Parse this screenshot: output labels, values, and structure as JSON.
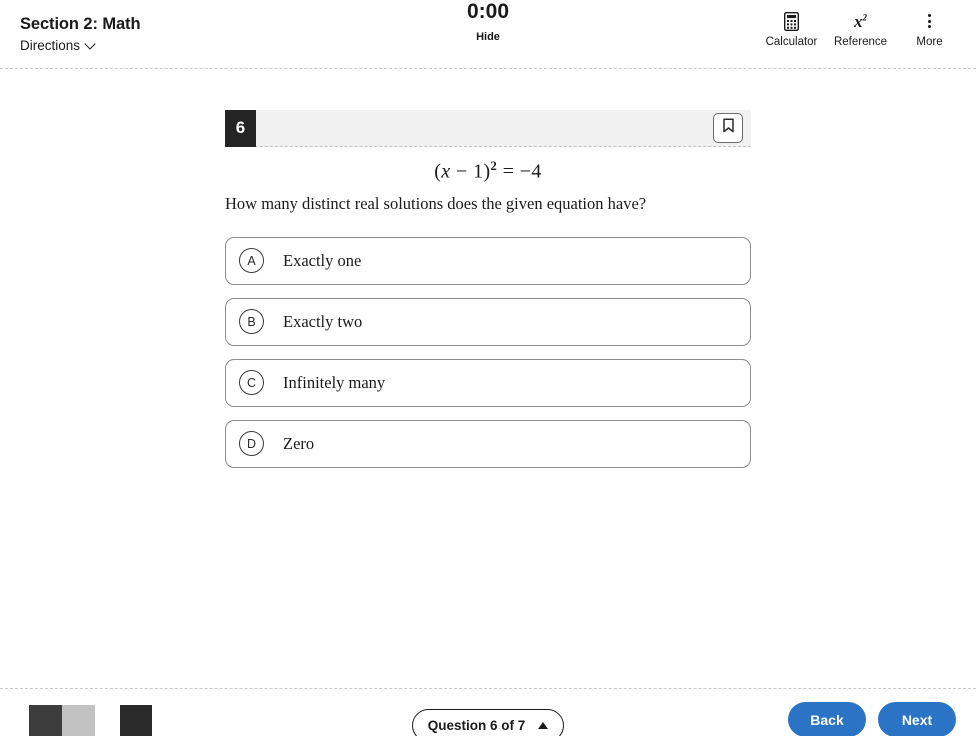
{
  "header": {
    "section_title": "Section 2: Math",
    "directions_label": "Directions",
    "directions_icon": "chevron-down-icon",
    "timer_value": "0:00",
    "timer_toggle_label": "Hide",
    "tools": [
      {
        "label": "Calculator",
        "icon": "calculator-icon"
      },
      {
        "label": "Reference",
        "icon": "x-squared-icon",
        "glyph_base": "x",
        "glyph_sup": "2"
      },
      {
        "label": "More",
        "icon": "kebab-menu-icon"
      }
    ]
  },
  "question": {
    "number": "6",
    "bookmark_icon": "bookmark-icon",
    "equation": {
      "lparen": "(",
      "variable": "x",
      "minus": " − ",
      "one": "1",
      "rparen": ")",
      "exponent": "2",
      "equals": " = ",
      "rhs": "−4"
    },
    "prompt": "How many distinct real solutions does the given equation have?",
    "choices": [
      {
        "letter": "A",
        "text": "Exactly one"
      },
      {
        "letter": "B",
        "text": "Exactly two"
      },
      {
        "letter": "C",
        "text": "Infinitely many"
      },
      {
        "letter": "D",
        "text": "Zero"
      }
    ]
  },
  "footer": {
    "question_selector_label": "Question 6 of 7",
    "question_selector_icon": "triangle-up-icon",
    "back_label": "Back",
    "next_label": "Next",
    "redacted_blocks": [
      "#3c3c3c",
      "#c2c2c2",
      "#2a2a2a"
    ]
  },
  "colors": {
    "accent_blue": "#2a73c5",
    "badge_dark": "#242424",
    "header_gray": "#f1f1f1",
    "rule_gray": "#c9c9c9"
  }
}
